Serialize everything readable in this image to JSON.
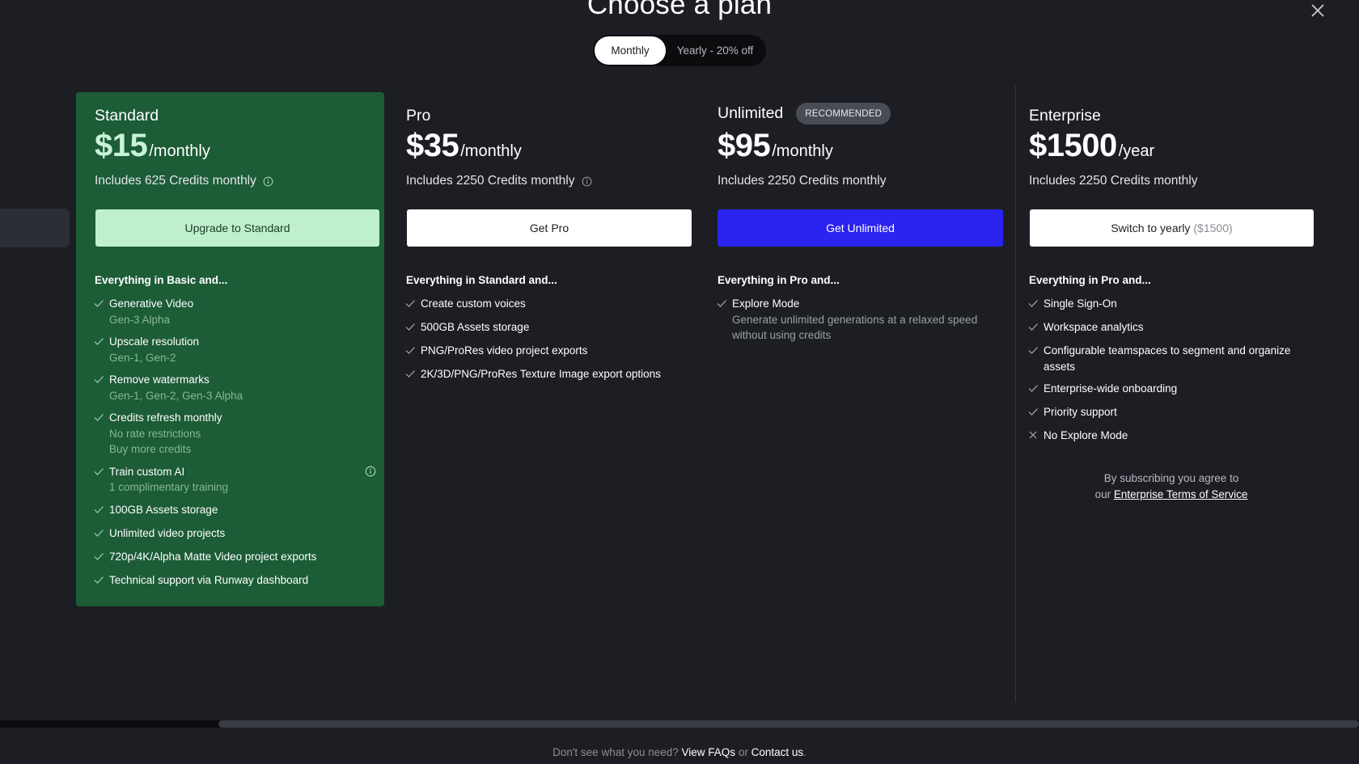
{
  "header": {
    "title": "Choose a plan",
    "billing_toggle": {
      "monthly": "Monthly",
      "yearly": "Yearly - 20% off",
      "selected": "Monthly"
    }
  },
  "plans": [
    {
      "name": "Standard",
      "price": "$15",
      "period": "/monthly",
      "credits": "Includes 625 Credits monthly",
      "cta": "Upgrade to Standard",
      "features_heading": "Everything in Basic and...",
      "features": [
        {
          "text": "Generative Video",
          "sub": [
            "Gen-3 Alpha"
          ]
        },
        {
          "text": "Upscale resolution",
          "sub": [
            "Gen-1, Gen-2"
          ]
        },
        {
          "text": "Remove watermarks",
          "sub": [
            "Gen-1, Gen-2, Gen-3 Alpha"
          ]
        },
        {
          "text": "Credits refresh monthly",
          "sub": [
            "No rate restrictions",
            "Buy more credits"
          ]
        },
        {
          "text": "Train custom AI",
          "sub": [
            "1 complimentary training"
          ]
        },
        {
          "text": "100GB Assets storage",
          "sub": []
        },
        {
          "text": "Unlimited video projects",
          "sub": []
        },
        {
          "text": "720p/4K/Alpha Matte Video project exports",
          "sub": []
        },
        {
          "text": "Technical support via Runway dashboard",
          "sub": []
        }
      ]
    },
    {
      "name": "Pro",
      "price": "$35",
      "period": "/monthly",
      "credits": "Includes 2250 Credits monthly",
      "cta": "Get Pro",
      "features_heading": "Everything in Standard and...",
      "features": [
        {
          "text": "Create custom voices"
        },
        {
          "text": "500GB Assets storage"
        },
        {
          "text": "PNG/ProRes video project exports"
        },
        {
          "text": "2K/3D/PNG/ProRes Texture Image export options"
        }
      ]
    },
    {
      "name": "Unlimited",
      "badge": "RECOMMENDED",
      "price": "$95",
      "period": "/monthly",
      "credits": "Includes 2250 Credits monthly",
      "cta": "Get Unlimited",
      "features_heading": "Everything in Pro and...",
      "features": [
        {
          "text": "Explore Mode",
          "sub": [
            "Generate unlimited generations at a relaxed speed",
            "without using credits"
          ]
        }
      ]
    },
    {
      "name": "Enterprise",
      "price": "$1500",
      "period": "/year",
      "credits": "Includes 2250 Credits monthly",
      "cta": "Switch to yearly",
      "cta_muted": "($1500)",
      "features_heading": "Everything in Pro and...",
      "features": [
        {
          "text": "Single Sign-On",
          "sub": []
        },
        {
          "text": "Workspace analytics",
          "sub": []
        },
        {
          "text": "Configurable teamspaces to segment and organize",
          "sub": [
            "assets"
          ]
        },
        {
          "text": "Enterprise-wide onboarding",
          "sub": []
        },
        {
          "text": "Priority support",
          "sub": []
        },
        {
          "text": "No Explore Mode",
          "sub": [],
          "excluded": true
        }
      ],
      "terms_line1": "By subscribing you agree to",
      "terms_prefix": "our",
      "terms_link": "Enterprise Terms of Service"
    }
  ],
  "footer": {
    "prefix": "Don't see what you need?",
    "faq_link": "View FAQs",
    "or": "or",
    "contact_link": "Contact us",
    "suffix": "."
  },
  "colors": {
    "background": "#1d1e24",
    "standard_card": "#1c5c37",
    "standard_button": "#bef0cc",
    "unlimited_button": "#2b24f0"
  }
}
